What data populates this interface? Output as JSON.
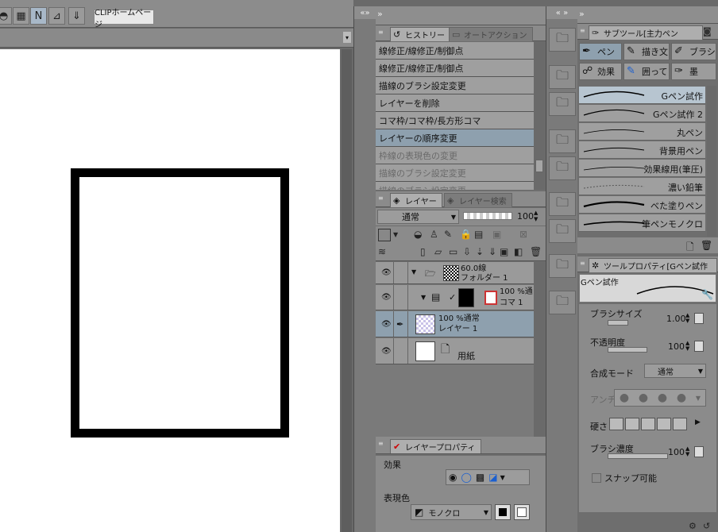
{
  "toolbar": {
    "clip_home_label": "CLIPホームページ"
  },
  "history": {
    "tab_label": "ヒストリー",
    "tab2_label": "オートアクション",
    "items": [
      {
        "label": "線修正/線修正/制御点",
        "state": "normal"
      },
      {
        "label": "線修正/線修正/制御点",
        "state": "normal"
      },
      {
        "label": "描線のブラシ設定変更",
        "state": "normal"
      },
      {
        "label": "レイヤーを削除",
        "state": "normal"
      },
      {
        "label": "コマ枠/コマ枠/長方形コマ",
        "state": "normal"
      },
      {
        "label": "レイヤーの順序変更",
        "state": "selected"
      },
      {
        "label": "枠線の表現色の変更",
        "state": "dim"
      },
      {
        "label": "描線のブラシ設定変更",
        "state": "dim"
      },
      {
        "label": "描線のブラシ設定変更",
        "state": "dim"
      }
    ]
  },
  "layers": {
    "tab_label": "レイヤー",
    "tab2_label": "レイヤー検索",
    "blend_mode": "通常",
    "opacity": "100",
    "rows": [
      {
        "line1": "60.0線",
        "line2": "フォルダー 1"
      },
      {
        "line1": "100 %通",
        "line2": "コマ 1"
      },
      {
        "line1": "100 %通常",
        "line2": "レイヤー 1"
      },
      {
        "line1": "用紙",
        "line2": ""
      }
    ]
  },
  "layer_property": {
    "tab_label": "レイヤープロパティ",
    "effect_label": "効果",
    "color_label": "表現色",
    "color_value": "モノクロ"
  },
  "subtool": {
    "tab_label": "サブツール[主力ペン",
    "buttons": [
      {
        "label": "ペン",
        "icon": "pen-icon"
      },
      {
        "label": "描き文",
        "icon": "marker-icon"
      },
      {
        "label": "ブラシ",
        "icon": "brush-icon"
      },
      {
        "label": "効果",
        "icon": "effect-icon"
      },
      {
        "label": "囲って",
        "icon": "fill-icon"
      },
      {
        "label": "墨",
        "icon": "ink-icon"
      }
    ],
    "brushes": [
      "Gペン試作",
      "Gペン試作 2",
      "丸ペン",
      "背景用ペン",
      "効果線用(筆圧)",
      "濃い鉛筆",
      "べた塗りペン",
      "筆ペンモノクロ"
    ]
  },
  "tool_property": {
    "tab_label": "ツールプロパティ[Gペン試作",
    "preview_name": "Gペン試作",
    "brush_size_label": "ブラシサイズ",
    "brush_size_value": "1.00",
    "opacity_label": "不透明度",
    "opacity_value": "100",
    "blend_label": "合成モード",
    "blend_value": "通常",
    "antialias_label": "アンチ",
    "hardness_label": "硬さ",
    "density_label": "ブラシ濃度",
    "density_value": "100",
    "snap_label": "スナップ可能"
  }
}
